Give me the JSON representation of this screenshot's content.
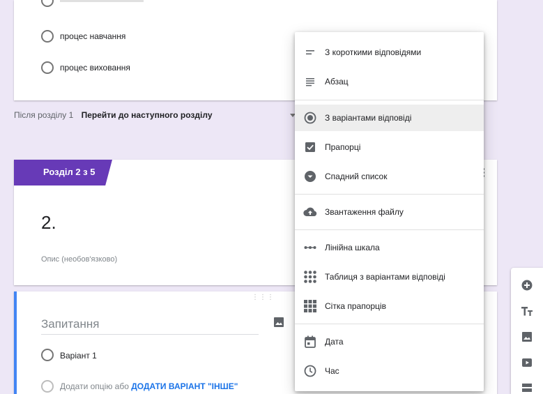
{
  "section1": {
    "options": [
      "процес навчання",
      "процес виховання"
    ],
    "after_section_label": "Після розділу 1",
    "after_section_value": "Перейти до наступного розділу"
  },
  "section2": {
    "tag": "Розділ 2 з 5",
    "title": "2.",
    "description_placeholder": "Опис (необов'язково)"
  },
  "question": {
    "title_placeholder": "Запитання",
    "options": [
      "Варіант 1"
    ],
    "add_option": "Додати опцію",
    "or": "або",
    "add_other": "ДОДАТИ ВАРІАНТ \"ІНШЕ\""
  },
  "menu": {
    "items": [
      {
        "label": "З короткими відповідями",
        "icon": "short-answer-icon"
      },
      {
        "label": "Абзац",
        "icon": "paragraph-icon"
      },
      {
        "label": "З варіантами відповіді",
        "icon": "radio-icon",
        "selected": true
      },
      {
        "label": "Прапорці",
        "icon": "checkbox-icon"
      },
      {
        "label": "Спадний список",
        "icon": "dropdown-icon"
      },
      {
        "label": "Звантаження файлу",
        "icon": "upload-icon"
      },
      {
        "label": "Лінійна шкала",
        "icon": "linear-scale-icon"
      },
      {
        "label": "Таблиця з варіантами відповіді",
        "icon": "grid-radio-icon"
      },
      {
        "label": "Сітка прапорців",
        "icon": "grid-checkbox-icon"
      },
      {
        "label": "Дата",
        "icon": "calendar-icon"
      },
      {
        "label": "Час",
        "icon": "clock-icon"
      }
    ]
  },
  "toolbar": {
    "items": [
      "add-question-icon",
      "add-title-icon",
      "add-image-icon",
      "add-video-icon",
      "add-section-icon"
    ]
  },
  "colors": {
    "accent": "#673ab7",
    "focus": "#4285f4",
    "link": "#1a73e8"
  }
}
